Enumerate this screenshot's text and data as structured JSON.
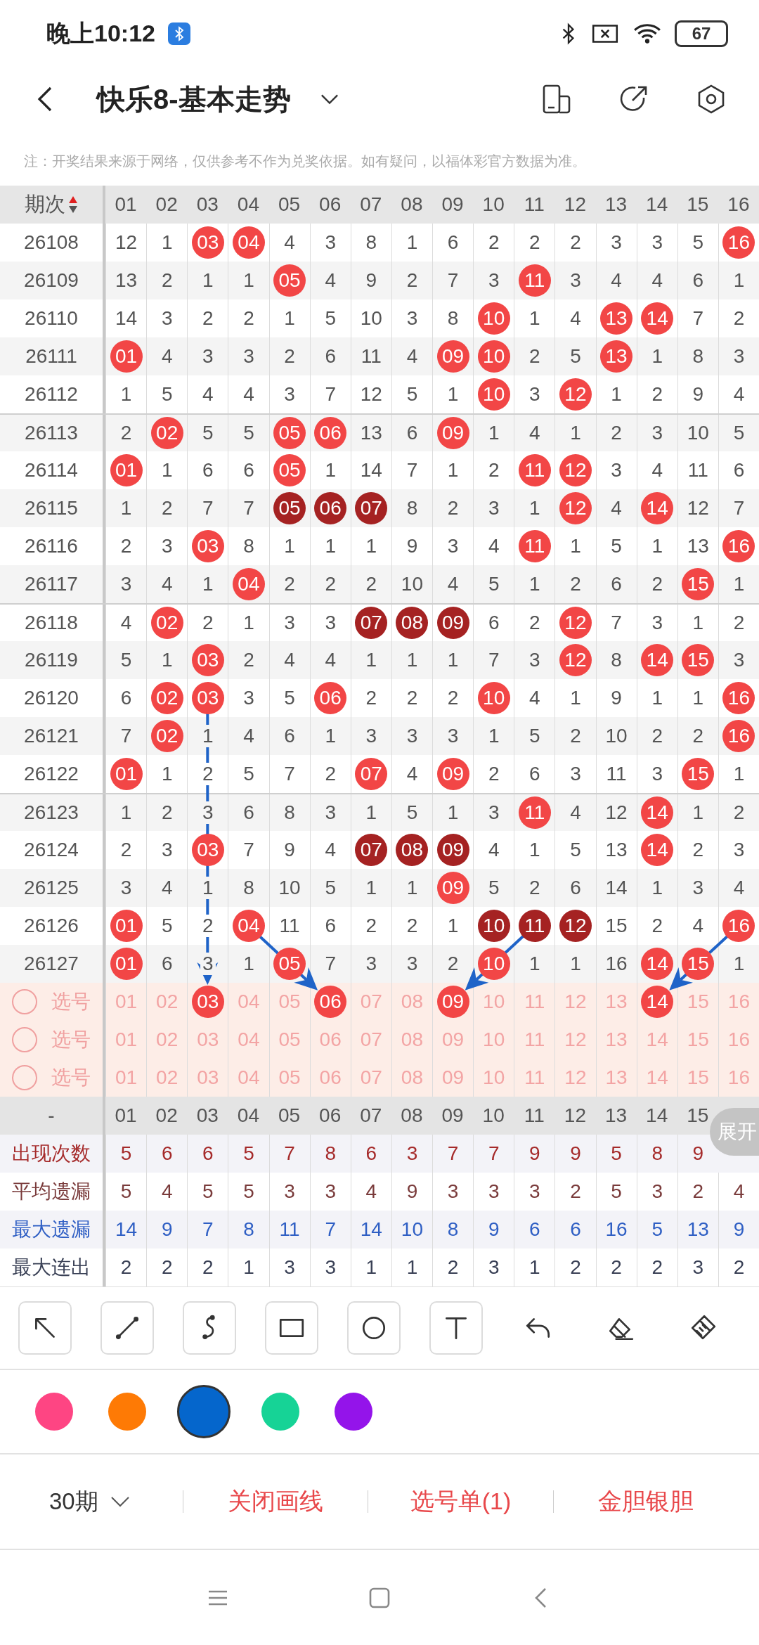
{
  "status_bar": {
    "time": "晚上10:12",
    "battery": "67"
  },
  "title_bar": {
    "title": "快乐8-基本走势"
  },
  "note": "注：开奖结果来源于网络，仅供参考不作为兑奖依据。如有疑问，以福体彩官方数据为准。",
  "table": {
    "period_header": "期次",
    "columns": [
      "01",
      "02",
      "03",
      "04",
      "05",
      "06",
      "07",
      "08",
      "09",
      "10",
      "11",
      "12",
      "13",
      "14",
      "15",
      "16"
    ],
    "rows": [
      {
        "period": "26108",
        "cells": [
          {
            "text": "12",
            "kind": "miss"
          },
          {
            "text": "1",
            "kind": "miss"
          },
          {
            "text": "03",
            "kind": "hit"
          },
          {
            "text": "04",
            "kind": "hit"
          },
          {
            "text": "4",
            "kind": "miss"
          },
          {
            "text": "3",
            "kind": "miss"
          },
          {
            "text": "8",
            "kind": "miss"
          },
          {
            "text": "1",
            "kind": "miss"
          },
          {
            "text": "6",
            "kind": "miss"
          },
          {
            "text": "2",
            "kind": "miss"
          },
          {
            "text": "2",
            "kind": "miss"
          },
          {
            "text": "2",
            "kind": "miss"
          },
          {
            "text": "3",
            "kind": "miss"
          },
          {
            "text": "3",
            "kind": "miss"
          },
          {
            "text": "5",
            "kind": "miss"
          },
          {
            "text": "16",
            "kind": "hit"
          }
        ]
      },
      {
        "period": "26109",
        "cells": [
          {
            "text": "13",
            "kind": "miss"
          },
          {
            "text": "2",
            "kind": "miss"
          },
          {
            "text": "1",
            "kind": "miss"
          },
          {
            "text": "1",
            "kind": "miss"
          },
          {
            "text": "05",
            "kind": "hit"
          },
          {
            "text": "4",
            "kind": "miss"
          },
          {
            "text": "9",
            "kind": "miss"
          },
          {
            "text": "2",
            "kind": "miss"
          },
          {
            "text": "7",
            "kind": "miss"
          },
          {
            "text": "3",
            "kind": "miss"
          },
          {
            "text": "11",
            "kind": "hit"
          },
          {
            "text": "3",
            "kind": "miss"
          },
          {
            "text": "4",
            "kind": "miss"
          },
          {
            "text": "4",
            "kind": "miss"
          },
          {
            "text": "6",
            "kind": "miss"
          },
          {
            "text": "1",
            "kind": "miss"
          }
        ]
      },
      {
        "period": "26110",
        "cells": [
          {
            "text": "14",
            "kind": "miss"
          },
          {
            "text": "3",
            "kind": "miss"
          },
          {
            "text": "2",
            "kind": "miss"
          },
          {
            "text": "2",
            "kind": "miss"
          },
          {
            "text": "1",
            "kind": "miss"
          },
          {
            "text": "5",
            "kind": "miss"
          },
          {
            "text": "10",
            "kind": "miss"
          },
          {
            "text": "3",
            "kind": "miss"
          },
          {
            "text": "8",
            "kind": "miss"
          },
          {
            "text": "10",
            "kind": "hit"
          },
          {
            "text": "1",
            "kind": "miss"
          },
          {
            "text": "4",
            "kind": "miss"
          },
          {
            "text": "13",
            "kind": "hit"
          },
          {
            "text": "14",
            "kind": "hit"
          },
          {
            "text": "7",
            "kind": "miss"
          },
          {
            "text": "2",
            "kind": "miss"
          }
        ]
      },
      {
        "period": "26111",
        "cells": [
          {
            "text": "01",
            "kind": "hit"
          },
          {
            "text": "4",
            "kind": "miss"
          },
          {
            "text": "3",
            "kind": "miss"
          },
          {
            "text": "3",
            "kind": "miss"
          },
          {
            "text": "2",
            "kind": "miss"
          },
          {
            "text": "6",
            "kind": "miss"
          },
          {
            "text": "11",
            "kind": "miss"
          },
          {
            "text": "4",
            "kind": "miss"
          },
          {
            "text": "09",
            "kind": "hit"
          },
          {
            "text": "10",
            "kind": "hit"
          },
          {
            "text": "2",
            "kind": "miss"
          },
          {
            "text": "5",
            "kind": "miss"
          },
          {
            "text": "13",
            "kind": "hit"
          },
          {
            "text": "1",
            "kind": "miss"
          },
          {
            "text": "8",
            "kind": "miss"
          },
          {
            "text": "3",
            "kind": "miss"
          }
        ]
      },
      {
        "period": "26112",
        "cells": [
          {
            "text": "1",
            "kind": "miss"
          },
          {
            "text": "5",
            "kind": "miss"
          },
          {
            "text": "4",
            "kind": "miss"
          },
          {
            "text": "4",
            "kind": "miss"
          },
          {
            "text": "3",
            "kind": "miss"
          },
          {
            "text": "7",
            "kind": "miss"
          },
          {
            "text": "12",
            "kind": "miss"
          },
          {
            "text": "5",
            "kind": "miss"
          },
          {
            "text": "1",
            "kind": "miss"
          },
          {
            "text": "10",
            "kind": "hit"
          },
          {
            "text": "3",
            "kind": "miss"
          },
          {
            "text": "12",
            "kind": "hit"
          },
          {
            "text": "1",
            "kind": "miss"
          },
          {
            "text": "2",
            "kind": "miss"
          },
          {
            "text": "9",
            "kind": "miss"
          },
          {
            "text": "4",
            "kind": "miss"
          }
        ]
      },
      {
        "period": "26113",
        "cells": [
          {
            "text": "2",
            "kind": "miss"
          },
          {
            "text": "02",
            "kind": "hit"
          },
          {
            "text": "5",
            "kind": "miss"
          },
          {
            "text": "5",
            "kind": "miss"
          },
          {
            "text": "05",
            "kind": "hit"
          },
          {
            "text": "06",
            "kind": "hit"
          },
          {
            "text": "13",
            "kind": "miss"
          },
          {
            "text": "6",
            "kind": "miss"
          },
          {
            "text": "09",
            "kind": "hit"
          },
          {
            "text": "1",
            "kind": "miss"
          },
          {
            "text": "4",
            "kind": "miss"
          },
          {
            "text": "1",
            "kind": "miss"
          },
          {
            "text": "2",
            "kind": "miss"
          },
          {
            "text": "3",
            "kind": "miss"
          },
          {
            "text": "10",
            "kind": "miss"
          },
          {
            "text": "5",
            "kind": "miss"
          }
        ]
      },
      {
        "period": "26114",
        "cells": [
          {
            "text": "01",
            "kind": "hit"
          },
          {
            "text": "1",
            "kind": "miss"
          },
          {
            "text": "6",
            "kind": "miss"
          },
          {
            "text": "6",
            "kind": "miss"
          },
          {
            "text": "05",
            "kind": "hit"
          },
          {
            "text": "1",
            "kind": "miss"
          },
          {
            "text": "14",
            "kind": "miss"
          },
          {
            "text": "7",
            "kind": "miss"
          },
          {
            "text": "1",
            "kind": "miss"
          },
          {
            "text": "2",
            "kind": "miss"
          },
          {
            "text": "11",
            "kind": "hit"
          },
          {
            "text": "12",
            "kind": "hit"
          },
          {
            "text": "3",
            "kind": "miss"
          },
          {
            "text": "4",
            "kind": "miss"
          },
          {
            "text": "11",
            "kind": "miss"
          },
          {
            "text": "6",
            "kind": "miss"
          }
        ]
      },
      {
        "period": "26115",
        "cells": [
          {
            "text": "1",
            "kind": "miss"
          },
          {
            "text": "2",
            "kind": "miss"
          },
          {
            "text": "7",
            "kind": "miss"
          },
          {
            "text": "7",
            "kind": "miss"
          },
          {
            "text": "05",
            "kind": "streak"
          },
          {
            "text": "06",
            "kind": "streak"
          },
          {
            "text": "07",
            "kind": "streak"
          },
          {
            "text": "8",
            "kind": "miss"
          },
          {
            "text": "2",
            "kind": "miss"
          },
          {
            "text": "3",
            "kind": "miss"
          },
          {
            "text": "1",
            "kind": "miss"
          },
          {
            "text": "12",
            "kind": "hit"
          },
          {
            "text": "4",
            "kind": "miss"
          },
          {
            "text": "14",
            "kind": "hit"
          },
          {
            "text": "12",
            "kind": "miss"
          },
          {
            "text": "7",
            "kind": "miss"
          }
        ]
      },
      {
        "period": "26116",
        "cells": [
          {
            "text": "2",
            "kind": "miss"
          },
          {
            "text": "3",
            "kind": "miss"
          },
          {
            "text": "03",
            "kind": "hit"
          },
          {
            "text": "8",
            "kind": "miss"
          },
          {
            "text": "1",
            "kind": "miss"
          },
          {
            "text": "1",
            "kind": "miss"
          },
          {
            "text": "1",
            "kind": "miss"
          },
          {
            "text": "9",
            "kind": "miss"
          },
          {
            "text": "3",
            "kind": "miss"
          },
          {
            "text": "4",
            "kind": "miss"
          },
          {
            "text": "11",
            "kind": "hit"
          },
          {
            "text": "1",
            "kind": "miss"
          },
          {
            "text": "5",
            "kind": "miss"
          },
          {
            "text": "1",
            "kind": "miss"
          },
          {
            "text": "13",
            "kind": "miss"
          },
          {
            "text": "16",
            "kind": "hit"
          }
        ]
      },
      {
        "period": "26117",
        "cells": [
          {
            "text": "3",
            "kind": "miss"
          },
          {
            "text": "4",
            "kind": "miss"
          },
          {
            "text": "1",
            "kind": "miss"
          },
          {
            "text": "04",
            "kind": "hit"
          },
          {
            "text": "2",
            "kind": "miss"
          },
          {
            "text": "2",
            "kind": "miss"
          },
          {
            "text": "2",
            "kind": "miss"
          },
          {
            "text": "10",
            "kind": "miss"
          },
          {
            "text": "4",
            "kind": "miss"
          },
          {
            "text": "5",
            "kind": "miss"
          },
          {
            "text": "1",
            "kind": "miss"
          },
          {
            "text": "2",
            "kind": "miss"
          },
          {
            "text": "6",
            "kind": "miss"
          },
          {
            "text": "2",
            "kind": "miss"
          },
          {
            "text": "15",
            "kind": "hit"
          },
          {
            "text": "1",
            "kind": "miss"
          }
        ]
      },
      {
        "period": "26118",
        "cells": [
          {
            "text": "4",
            "kind": "miss"
          },
          {
            "text": "02",
            "kind": "hit"
          },
          {
            "text": "2",
            "kind": "miss"
          },
          {
            "text": "1",
            "kind": "miss"
          },
          {
            "text": "3",
            "kind": "miss"
          },
          {
            "text": "3",
            "kind": "miss"
          },
          {
            "text": "07",
            "kind": "streak"
          },
          {
            "text": "08",
            "kind": "streak"
          },
          {
            "text": "09",
            "kind": "streak"
          },
          {
            "text": "6",
            "kind": "miss"
          },
          {
            "text": "2",
            "kind": "miss"
          },
          {
            "text": "12",
            "kind": "hit"
          },
          {
            "text": "7",
            "kind": "miss"
          },
          {
            "text": "3",
            "kind": "miss"
          },
          {
            "text": "1",
            "kind": "miss"
          },
          {
            "text": "2",
            "kind": "miss"
          }
        ]
      },
      {
        "period": "26119",
        "cells": [
          {
            "text": "5",
            "kind": "miss"
          },
          {
            "text": "1",
            "kind": "miss"
          },
          {
            "text": "03",
            "kind": "hit"
          },
          {
            "text": "2",
            "kind": "miss"
          },
          {
            "text": "4",
            "kind": "miss"
          },
          {
            "text": "4",
            "kind": "miss"
          },
          {
            "text": "1",
            "kind": "miss"
          },
          {
            "text": "1",
            "kind": "miss"
          },
          {
            "text": "1",
            "kind": "miss"
          },
          {
            "text": "7",
            "kind": "miss"
          },
          {
            "text": "3",
            "kind": "miss"
          },
          {
            "text": "12",
            "kind": "hit"
          },
          {
            "text": "8",
            "kind": "miss"
          },
          {
            "text": "14",
            "kind": "hit"
          },
          {
            "text": "15",
            "kind": "hit"
          },
          {
            "text": "3",
            "kind": "miss"
          }
        ]
      },
      {
        "period": "26120",
        "cells": [
          {
            "text": "6",
            "kind": "miss"
          },
          {
            "text": "02",
            "kind": "hit"
          },
          {
            "text": "03",
            "kind": "hit"
          },
          {
            "text": "3",
            "kind": "miss"
          },
          {
            "text": "5",
            "kind": "miss"
          },
          {
            "text": "06",
            "kind": "hit"
          },
          {
            "text": "2",
            "kind": "miss"
          },
          {
            "text": "2",
            "kind": "miss"
          },
          {
            "text": "2",
            "kind": "miss"
          },
          {
            "text": "10",
            "kind": "hit"
          },
          {
            "text": "4",
            "kind": "miss"
          },
          {
            "text": "1",
            "kind": "miss"
          },
          {
            "text": "9",
            "kind": "miss"
          },
          {
            "text": "1",
            "kind": "miss"
          },
          {
            "text": "1",
            "kind": "miss"
          },
          {
            "text": "16",
            "kind": "hit"
          }
        ]
      },
      {
        "period": "26121",
        "cells": [
          {
            "text": "7",
            "kind": "miss"
          },
          {
            "text": "02",
            "kind": "hit"
          },
          {
            "text": "1",
            "kind": "miss"
          },
          {
            "text": "4",
            "kind": "miss"
          },
          {
            "text": "6",
            "kind": "miss"
          },
          {
            "text": "1",
            "kind": "miss"
          },
          {
            "text": "3",
            "kind": "miss"
          },
          {
            "text": "3",
            "kind": "miss"
          },
          {
            "text": "3",
            "kind": "miss"
          },
          {
            "text": "1",
            "kind": "miss"
          },
          {
            "text": "5",
            "kind": "miss"
          },
          {
            "text": "2",
            "kind": "miss"
          },
          {
            "text": "10",
            "kind": "miss"
          },
          {
            "text": "2",
            "kind": "miss"
          },
          {
            "text": "2",
            "kind": "miss"
          },
          {
            "text": "16",
            "kind": "hit"
          }
        ]
      },
      {
        "period": "26122",
        "cells": [
          {
            "text": "01",
            "kind": "hit"
          },
          {
            "text": "1",
            "kind": "miss"
          },
          {
            "text": "2",
            "kind": "miss"
          },
          {
            "text": "5",
            "kind": "miss"
          },
          {
            "text": "7",
            "kind": "miss"
          },
          {
            "text": "2",
            "kind": "miss"
          },
          {
            "text": "07",
            "kind": "hit"
          },
          {
            "text": "4",
            "kind": "miss"
          },
          {
            "text": "09",
            "kind": "hit"
          },
          {
            "text": "2",
            "kind": "miss"
          },
          {
            "text": "6",
            "kind": "miss"
          },
          {
            "text": "3",
            "kind": "miss"
          },
          {
            "text": "11",
            "kind": "miss"
          },
          {
            "text": "3",
            "kind": "miss"
          },
          {
            "text": "15",
            "kind": "hit"
          },
          {
            "text": "1",
            "kind": "miss"
          }
        ]
      },
      {
        "period": "26123",
        "cells": [
          {
            "text": "1",
            "kind": "miss"
          },
          {
            "text": "2",
            "kind": "miss"
          },
          {
            "text": "3",
            "kind": "miss"
          },
          {
            "text": "6",
            "kind": "miss"
          },
          {
            "text": "8",
            "kind": "miss"
          },
          {
            "text": "3",
            "kind": "miss"
          },
          {
            "text": "1",
            "kind": "miss"
          },
          {
            "text": "5",
            "kind": "miss"
          },
          {
            "text": "1",
            "kind": "miss"
          },
          {
            "text": "3",
            "kind": "miss"
          },
          {
            "text": "11",
            "kind": "hit"
          },
          {
            "text": "4",
            "kind": "miss"
          },
          {
            "text": "12",
            "kind": "miss"
          },
          {
            "text": "14",
            "kind": "hit"
          },
          {
            "text": "1",
            "kind": "miss"
          },
          {
            "text": "2",
            "kind": "miss"
          }
        ]
      },
      {
        "period": "26124",
        "cells": [
          {
            "text": "2",
            "kind": "miss"
          },
          {
            "text": "3",
            "kind": "miss"
          },
          {
            "text": "03",
            "kind": "hit"
          },
          {
            "text": "7",
            "kind": "miss"
          },
          {
            "text": "9",
            "kind": "miss"
          },
          {
            "text": "4",
            "kind": "miss"
          },
          {
            "text": "07",
            "kind": "streak"
          },
          {
            "text": "08",
            "kind": "streak"
          },
          {
            "text": "09",
            "kind": "streak"
          },
          {
            "text": "4",
            "kind": "miss"
          },
          {
            "text": "1",
            "kind": "miss"
          },
          {
            "text": "5",
            "kind": "miss"
          },
          {
            "text": "13",
            "kind": "miss"
          },
          {
            "text": "14",
            "kind": "hit"
          },
          {
            "text": "2",
            "kind": "miss"
          },
          {
            "text": "3",
            "kind": "miss"
          }
        ]
      },
      {
        "period": "26125",
        "cells": [
          {
            "text": "3",
            "kind": "miss"
          },
          {
            "text": "4",
            "kind": "miss"
          },
          {
            "text": "1",
            "kind": "miss"
          },
          {
            "text": "8",
            "kind": "miss"
          },
          {
            "text": "10",
            "kind": "miss"
          },
          {
            "text": "5",
            "kind": "miss"
          },
          {
            "text": "1",
            "kind": "miss"
          },
          {
            "text": "1",
            "kind": "miss"
          },
          {
            "text": "09",
            "kind": "hit"
          },
          {
            "text": "5",
            "kind": "miss"
          },
          {
            "text": "2",
            "kind": "miss"
          },
          {
            "text": "6",
            "kind": "miss"
          },
          {
            "text": "14",
            "kind": "miss"
          },
          {
            "text": "1",
            "kind": "miss"
          },
          {
            "text": "3",
            "kind": "miss"
          },
          {
            "text": "4",
            "kind": "miss"
          }
        ]
      },
      {
        "period": "26126",
        "cells": [
          {
            "text": "01",
            "kind": "hit"
          },
          {
            "text": "5",
            "kind": "miss"
          },
          {
            "text": "2",
            "kind": "miss"
          },
          {
            "text": "04",
            "kind": "hit"
          },
          {
            "text": "11",
            "kind": "miss"
          },
          {
            "text": "6",
            "kind": "miss"
          },
          {
            "text": "2",
            "kind": "miss"
          },
          {
            "text": "2",
            "kind": "miss"
          },
          {
            "text": "1",
            "kind": "miss"
          },
          {
            "text": "10",
            "kind": "streak"
          },
          {
            "text": "11",
            "kind": "streak"
          },
          {
            "text": "12",
            "kind": "streak"
          },
          {
            "text": "15",
            "kind": "miss"
          },
          {
            "text": "2",
            "kind": "miss"
          },
          {
            "text": "4",
            "kind": "miss"
          },
          {
            "text": "16",
            "kind": "hit"
          }
        ]
      },
      {
        "period": "26127",
        "cells": [
          {
            "text": "01",
            "kind": "hit"
          },
          {
            "text": "6",
            "kind": "miss"
          },
          {
            "text": "3",
            "kind": "miss"
          },
          {
            "text": "1",
            "kind": "miss"
          },
          {
            "text": "05",
            "kind": "hit"
          },
          {
            "text": "7",
            "kind": "miss"
          },
          {
            "text": "3",
            "kind": "miss"
          },
          {
            "text": "3",
            "kind": "miss"
          },
          {
            "text": "2",
            "kind": "miss"
          },
          {
            "text": "10",
            "kind": "hit"
          },
          {
            "text": "1",
            "kind": "miss"
          },
          {
            "text": "1",
            "kind": "miss"
          },
          {
            "text": "16",
            "kind": "miss"
          },
          {
            "text": "14",
            "kind": "hit"
          },
          {
            "text": "15",
            "kind": "hit"
          },
          {
            "text": "1",
            "kind": "miss"
          }
        ]
      }
    ]
  },
  "select_rows": [
    {
      "checked": false,
      "label": "选号",
      "numbers": [
        {
          "text": "01",
          "selected": false
        },
        {
          "text": "02",
          "selected": false
        },
        {
          "text": "03",
          "selected": true
        },
        {
          "text": "04",
          "selected": false
        },
        {
          "text": "05",
          "selected": false
        },
        {
          "text": "06",
          "selected": true
        },
        {
          "text": "07",
          "selected": false
        },
        {
          "text": "08",
          "selected": false
        },
        {
          "text": "09",
          "selected": true
        },
        {
          "text": "10",
          "selected": false
        },
        {
          "text": "11",
          "selected": false
        },
        {
          "text": "12",
          "selected": false
        },
        {
          "text": "13",
          "selected": false
        },
        {
          "text": "14",
          "selected": true
        },
        {
          "text": "15",
          "selected": false
        },
        {
          "text": "16",
          "selected": false
        }
      ]
    },
    {
      "checked": false,
      "label": "选号",
      "numbers": [
        {
          "text": "01",
          "selected": false
        },
        {
          "text": "02",
          "selected": false
        },
        {
          "text": "03",
          "selected": false
        },
        {
          "text": "04",
          "selected": false
        },
        {
          "text": "05",
          "selected": false
        },
        {
          "text": "06",
          "selected": false
        },
        {
          "text": "07",
          "selected": false
        },
        {
          "text": "08",
          "selected": false
        },
        {
          "text": "09",
          "selected": false
        },
        {
          "text": "10",
          "selected": false
        },
        {
          "text": "11",
          "selected": false
        },
        {
          "text": "12",
          "selected": false
        },
        {
          "text": "13",
          "selected": false
        },
        {
          "text": "14",
          "selected": false
        },
        {
          "text": "15",
          "selected": false
        },
        {
          "text": "16",
          "selected": false
        }
      ]
    },
    {
      "checked": false,
      "label": "选号",
      "numbers": [
        {
          "text": "01",
          "selected": false
        },
        {
          "text": "02",
          "selected": false
        },
        {
          "text": "03",
          "selected": false
        },
        {
          "text": "04",
          "selected": false
        },
        {
          "text": "05",
          "selected": false
        },
        {
          "text": "06",
          "selected": false
        },
        {
          "text": "07",
          "selected": false
        },
        {
          "text": "08",
          "selected": false
        },
        {
          "text": "09",
          "selected": false
        },
        {
          "text": "10",
          "selected": false
        },
        {
          "text": "11",
          "selected": false
        },
        {
          "text": "12",
          "selected": false
        },
        {
          "text": "13",
          "selected": false
        },
        {
          "text": "14",
          "selected": false
        },
        {
          "text": "15",
          "selected": false
        },
        {
          "text": "16",
          "selected": false
        }
      ]
    }
  ],
  "stats_header": {
    "label": "-",
    "columns": [
      "01",
      "02",
      "03",
      "04",
      "05",
      "06",
      "07",
      "08",
      "09",
      "10",
      "11",
      "12",
      "13",
      "14",
      "15"
    ]
  },
  "expand_button": "展开",
  "stats": [
    {
      "label": "出现次数",
      "color": "#a52a2a",
      "values": [
        "5",
        "6",
        "6",
        "5",
        "7",
        "8",
        "6",
        "3",
        "7",
        "7",
        "9",
        "9",
        "5",
        "8",
        "9"
      ]
    },
    {
      "label": "平均遗漏",
      "color": "#7a3b3b",
      "values": [
        "5",
        "4",
        "5",
        "5",
        "3",
        "3",
        "4",
        "9",
        "3",
        "3",
        "3",
        "2",
        "5",
        "3",
        "2",
        "4"
      ]
    },
    {
      "label": "最大遗漏",
      "color": "#2f5fc4",
      "values": [
        "14",
        "9",
        "7",
        "8",
        "11",
        "7",
        "14",
        "10",
        "8",
        "9",
        "6",
        "6",
        "16",
        "5",
        "13",
        "9"
      ]
    },
    {
      "label": "最大连出",
      "color": "#3a4156",
      "values": [
        "2",
        "2",
        "2",
        "1",
        "3",
        "3",
        "1",
        "1",
        "2",
        "3",
        "1",
        "2",
        "2",
        "2",
        "3",
        "2"
      ]
    }
  ],
  "tools": [
    {
      "kind": "arrow",
      "boxed": true
    },
    {
      "kind": "line",
      "boxed": true
    },
    {
      "kind": "curve",
      "boxed": true
    },
    {
      "kind": "rect",
      "boxed": true
    },
    {
      "kind": "circle",
      "boxed": true
    },
    {
      "kind": "text",
      "boxed": true
    },
    {
      "kind": "undo",
      "boxed": false
    },
    {
      "kind": "eraser",
      "boxed": false
    },
    {
      "kind": "brush",
      "boxed": false
    }
  ],
  "colors": [
    {
      "color": "#fe4583",
      "selected": false
    },
    {
      "color": "#fe7a05",
      "selected": false
    },
    {
      "color": "#0566cc",
      "selected": true
    },
    {
      "color": "#16d396",
      "selected": false
    },
    {
      "color": "#9414ea",
      "selected": false
    }
  ],
  "bottom_bar": {
    "period_select": "30期",
    "actions": [
      "关闭画线",
      "选号单(1)",
      "金胆银胆"
    ]
  }
}
